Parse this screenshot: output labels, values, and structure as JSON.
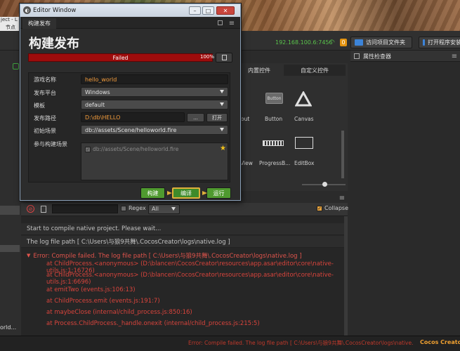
{
  "dialog": {
    "window_title": "Editor Window",
    "tab": "构建发布",
    "heading": "构建发布",
    "progress_status": "Failed",
    "progress_percent": "100%",
    "progress_value": 1.0,
    "form": {
      "game_name": {
        "label": "游戏名称",
        "value": "hello_world"
      },
      "platform": {
        "label": "发布平台",
        "value": "Windows"
      },
      "template": {
        "label": "模板",
        "value": "default"
      },
      "build_path": {
        "label": "发布路径",
        "value": "D:\\db\\HELLO",
        "ellipsis_button": "...",
        "open_button": "打开"
      },
      "start_scene": {
        "label": "初始场景",
        "value": "db://assets/Scene/helloworld.fire"
      },
      "included_scenes": {
        "label": "参与构建场景",
        "items": [
          "db://assets/Scene/helloworld.fire"
        ]
      }
    },
    "buttons": {
      "build": "构建",
      "compile": "编译",
      "run": "运行"
    }
  },
  "toolbar": {
    "ip": "192.168.100.6:7456",
    "badge": "0",
    "visit_dev_folder": "访问项目文件夹",
    "open_installer": "打开程序安装"
  },
  "left_strip": {
    "menu_a": "ject - L",
    "menu_b": "节点",
    "label_world": "orld..."
  },
  "widget_panel": {
    "tabs": [
      "内置控件",
      "自定义控件"
    ],
    "items": [
      {
        "label": "Button",
        "icon": "button-icon"
      },
      {
        "label": "Canvas",
        "icon": "canvas-icon"
      },
      {
        "label": "out",
        "icon": "layout-icon"
      },
      {
        "label": "lView",
        "icon": "scrollview-icon"
      },
      {
        "label": "ProgressB...",
        "icon": "progressbar-icon"
      },
      {
        "label": "EditBox",
        "icon": "editbox-icon"
      }
    ]
  },
  "inspector": {
    "title": "属性检查器"
  },
  "console": {
    "regex_label": "Regex",
    "filter_value": "All",
    "collapse_label": "Collapse",
    "lines": [
      {
        "kind": "info",
        "text": "Start to compile native project. Please wait..."
      },
      {
        "kind": "info",
        "text": "The log file path [ C:\\Users\\与狼9共舞\\.CocosCreator\\logs\\native.log ]"
      },
      {
        "kind": "error-head",
        "text": "Error: Compile failed. The log file path [ C:\\Users\\与狼9共舞\\.CocosCreator\\logs\\native.log ]"
      },
      {
        "kind": "error",
        "text": "at ChildProcess.<anonymous> (D:\\blancen\\CocosCreator\\resources\\app.asar\\editor\\core\\native-utils.js:1:16726)"
      },
      {
        "kind": "error",
        "text": "at ChildProcess.<anonymous> (D:\\blancen\\CocosCreator\\resources\\app.asar\\editor\\core\\native-utils.js:1:6696)"
      },
      {
        "kind": "error",
        "text": "at emitTwo (events.js:106:13)"
      },
      {
        "kind": "error",
        "text": "at ChildProcess.emit (events.js:191:7)"
      },
      {
        "kind": "error",
        "text": "at maybeClose (internal/child_process.js:850:16)"
      },
      {
        "kind": "error",
        "text": "at Process.ChildProcess._handle.onexit (internal/child_process.js:215:5)"
      }
    ]
  },
  "status_bar": {
    "message": "Error: Compile failed. The log file path [ C:\\Users\\与狼9共舞\\.CocosCreator\\logs\\native.log ]",
    "app_name": "Cocos Creator"
  },
  "colors": {
    "accent_green": "#59c34b",
    "error_red": "#d9443c",
    "progress_red": "#9e0c0c",
    "button_green": "#4f9a2f",
    "app_orange": "#f0a030"
  }
}
